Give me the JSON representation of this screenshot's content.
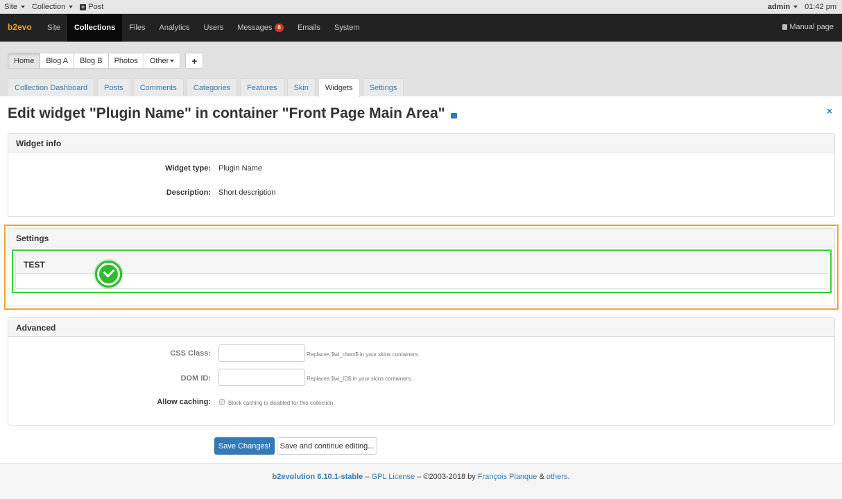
{
  "topbar": {
    "menus": [
      "Site",
      "Collection"
    ],
    "post_label": "Post",
    "user": "admin",
    "time": "01:42 pm"
  },
  "mainnav": {
    "brand": "b2evo",
    "items": [
      "Site",
      "Collections",
      "Files",
      "Analytics",
      "Users",
      "Messages",
      "Emails",
      "System"
    ],
    "messages_count": "6",
    "manual": "Manual page"
  },
  "collections": {
    "buttons": [
      "Home",
      "Blog A",
      "Blog B",
      "Photos",
      "Other"
    ],
    "add": "+"
  },
  "tabs": [
    "Collection Dashboard",
    "Posts",
    "Comments",
    "Categories",
    "Features",
    "Skin",
    "Widgets",
    "Settings"
  ],
  "page": {
    "title": "Edit widget \"Plugin Name\" in container \"Front Page Main Area\"",
    "close": "×"
  },
  "widget_info": {
    "heading": "Widget info",
    "type_label": "Widget type:",
    "type_value": "Plugin Name",
    "desc_label": "Description:",
    "desc_value": "Short description"
  },
  "settings": {
    "heading": "Settings",
    "sub_heading": "TEST"
  },
  "advanced": {
    "heading": "Advanced",
    "css_label": "CSS Class:",
    "css_hint": "Replaces $wi_class$ in your skins containers.",
    "dom_label": "DOM ID:",
    "dom_hint": "Replaces $wi_ID$ in your skins containers.",
    "cache_label": "Allow caching:",
    "cache_hint": "Block caching is disabled for this collection."
  },
  "actions": {
    "save": "Save Changes!",
    "save_continue": "Save and continue editing..."
  },
  "footer": {
    "product": "b2evolution 6.10.1-stable",
    "sep1": " – ",
    "license": "GPL License",
    "copyright": " – ©2003-2018 by ",
    "author": "François Planque",
    "amp": " & ",
    "others": "others",
    "dot": "."
  },
  "colors": {
    "brand": "#f59f28",
    "highlight_orange": "#f7a230",
    "highlight_green": "#31d131",
    "primary": "#337ab7",
    "badge": "#d9352b"
  }
}
